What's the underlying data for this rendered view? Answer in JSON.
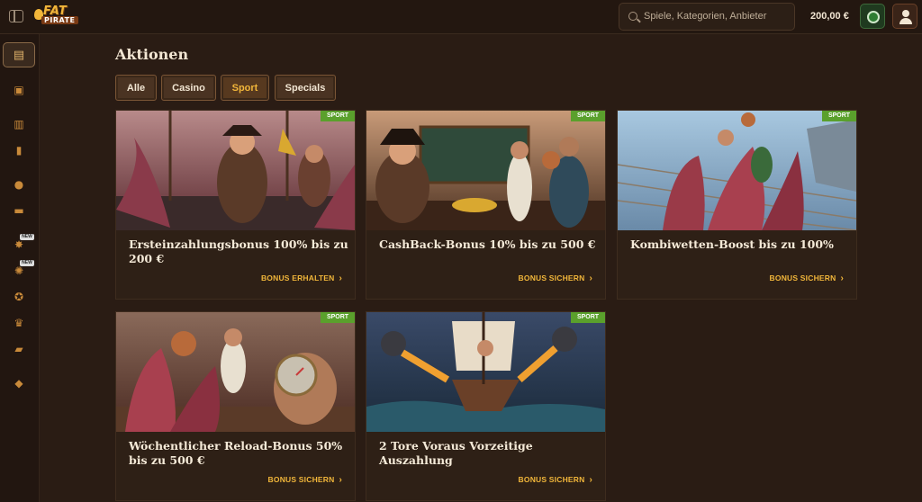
{
  "header": {
    "logo_top": "FAT",
    "logo_bottom": "PIRATE",
    "search_placeholder": "Spiele, Kategorien, Anbieter",
    "balance": "200,00 €"
  },
  "sidebar": {
    "items": [
      {
        "icon": "promotions-icon",
        "glyph": "▤"
      },
      {
        "icon": "gift-icon",
        "glyph": "▣"
      },
      {
        "icon": "casino-icon",
        "glyph": "▥"
      },
      {
        "icon": "cards-icon",
        "glyph": "▮"
      },
      {
        "icon": "sports-ball-icon",
        "glyph": "●"
      },
      {
        "icon": "live-icon",
        "glyph": "▬"
      },
      {
        "icon": "sports-new-icon",
        "glyph": "✸",
        "badge": "NEW"
      },
      {
        "icon": "soccer-new-icon",
        "glyph": "✺",
        "badge": "NEW"
      },
      {
        "icon": "medal-icon",
        "glyph": "✪"
      },
      {
        "icon": "trophy-icon",
        "glyph": "♛"
      },
      {
        "icon": "chest-icon",
        "glyph": "▰"
      },
      {
        "icon": "diamond-icon",
        "glyph": "◆"
      }
    ]
  },
  "main": {
    "title": "Aktionen",
    "filters": [
      {
        "label": "Alle",
        "active": false
      },
      {
        "label": "Casino",
        "active": false
      },
      {
        "label": "Sport",
        "active": true
      },
      {
        "label": "Specials",
        "active": false
      }
    ],
    "cards": [
      {
        "badge": "SPORT",
        "title": "Ersteinzahlungsbonus 100% bis zu 200 €",
        "cta": "BONUS ERHALTEN"
      },
      {
        "badge": "SPORT",
        "title": "CashBack-Bonus 10% bis zu 500 €",
        "cta": "BONUS SICHERN"
      },
      {
        "badge": "SPORT",
        "title": "Kombiwetten-Boost bis zu 100%",
        "cta": "BONUS SICHERN"
      },
      {
        "badge": "SPORT",
        "title": "Wöchentlicher Reload-Bonus 50% bis zu 500 €",
        "cta": "BONUS SICHERN"
      },
      {
        "badge": "SPORT",
        "title": "2 Tore Voraus Vorzeitige Auszahlung",
        "cta": "BONUS SICHERN"
      }
    ]
  },
  "colors": {
    "background": "#2a1c14",
    "accent": "#f1b63a",
    "badge_green": "#5aa02c"
  }
}
